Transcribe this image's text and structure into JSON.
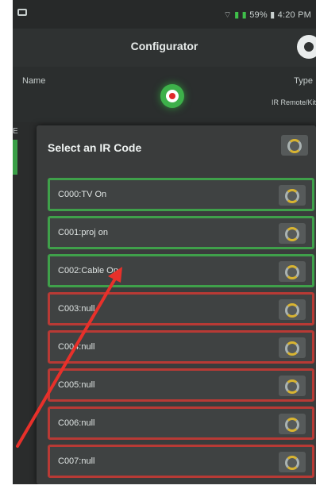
{
  "status_bar": {
    "icons": [
      "wifi-icon",
      "signal-icon",
      "signal-icon",
      "battery-icon"
    ],
    "battery": "59%",
    "time": "4:20 PM"
  },
  "app_bar": {
    "title": "Configurator",
    "settings_icon": "gear-icon"
  },
  "config": {
    "name_label": "Name",
    "type_label": "Type",
    "type_value": "IR Remote/Kit",
    "side_label": "E"
  },
  "dialog": {
    "title": "Select an IR Code",
    "refresh_icon": "refresh-icon",
    "codes": [
      {
        "label": "C000:TV On",
        "status": "assigned"
      },
      {
        "label": "C001:proj on",
        "status": "assigned"
      },
      {
        "label": "C002:Cable On",
        "status": "assigned"
      },
      {
        "label": "C003:null",
        "status": "empty"
      },
      {
        "label": "C004:null",
        "status": "empty"
      },
      {
        "label": "C005:null",
        "status": "empty"
      },
      {
        "label": "C006:null",
        "status": "empty"
      },
      {
        "label": "C007:null",
        "status": "empty"
      }
    ]
  },
  "colors": {
    "assigned_border": "#3fa04a",
    "empty_border": "#b83a35",
    "annotation_arrow": "#e8302a",
    "refresh_accent": "#d8b431"
  }
}
